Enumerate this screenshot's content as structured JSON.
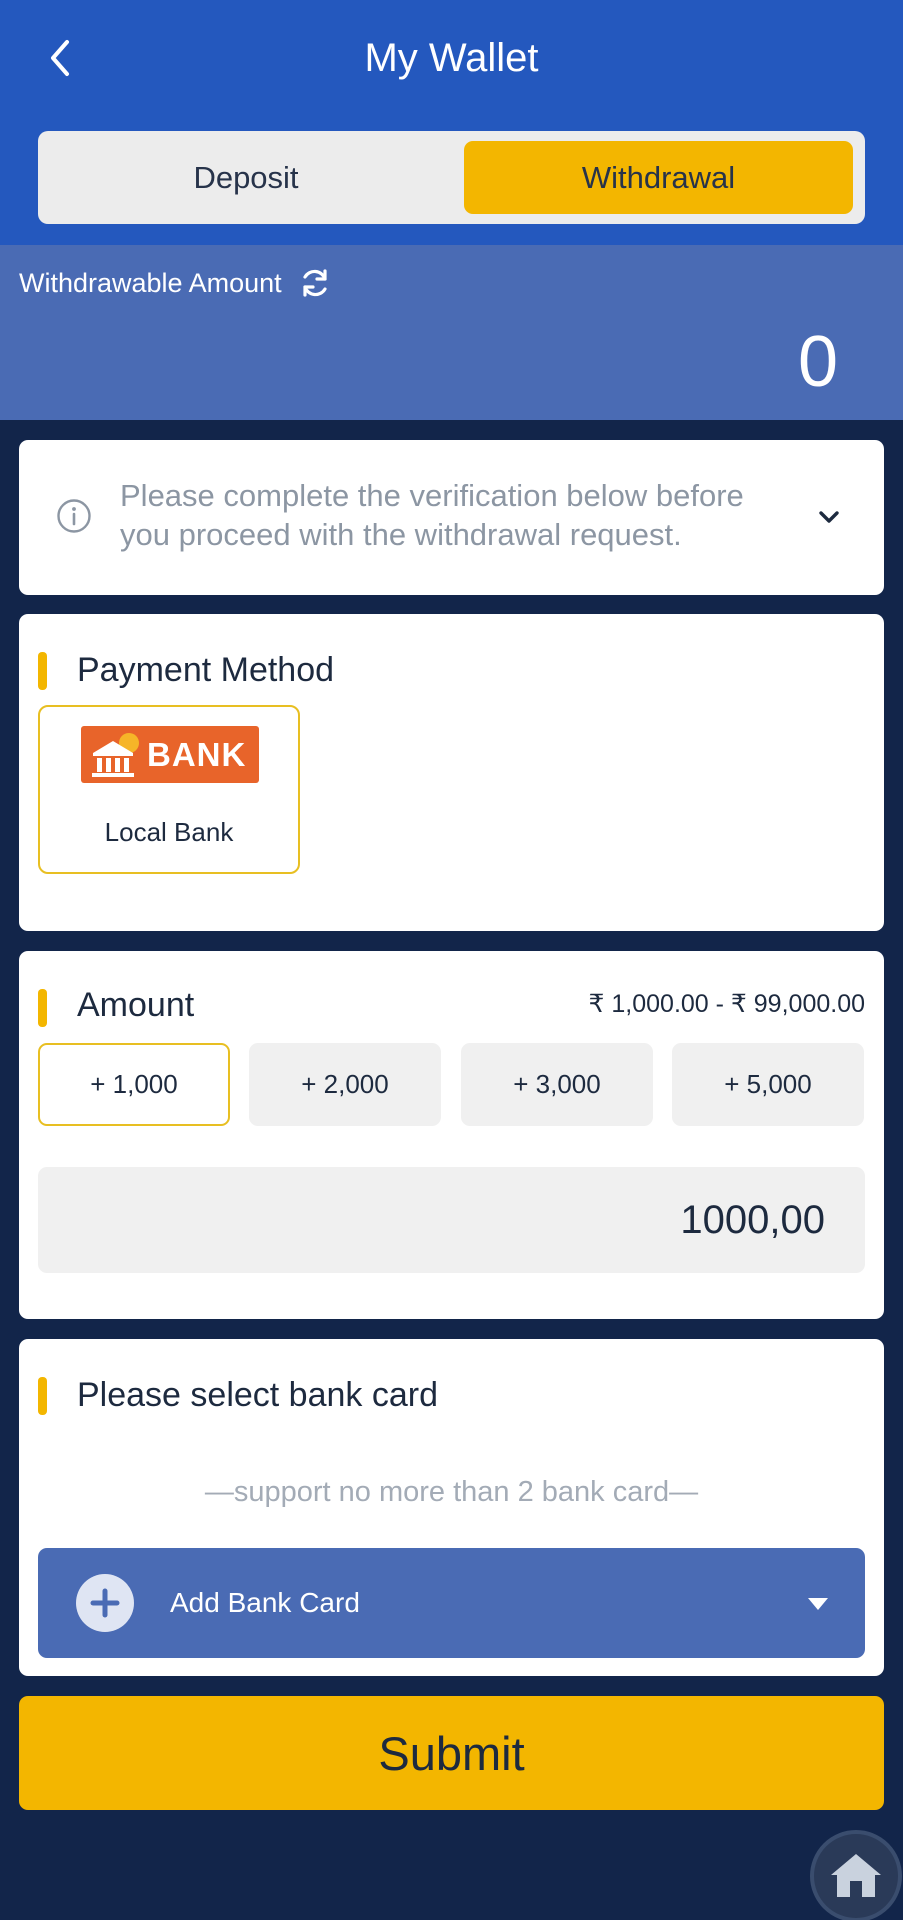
{
  "header": {
    "title": "My Wallet",
    "back_icon": "chevron-left-icon",
    "tabs": [
      {
        "label": "Deposit",
        "active": false
      },
      {
        "label": "Withdrawal",
        "active": true
      }
    ]
  },
  "balance": {
    "label": "Withdrawable Amount",
    "refresh_icon": "refresh-icon",
    "value": "0"
  },
  "notice": {
    "icon": "info-icon",
    "text": "Please complete the verification below before you proceed with the withdrawal request.",
    "expand_icon": "chevron-down-icon"
  },
  "payment": {
    "title": "Payment Method",
    "options": [
      {
        "logo_text": "BANK",
        "label": "Local Bank",
        "selected": true
      }
    ]
  },
  "amount": {
    "title": "Amount",
    "range": "₹ 1,000.00 - ₹ 99,000.00",
    "chips": [
      "+ 1,000",
      "+ 2,000",
      "+ 3,000",
      "+ 5,000"
    ],
    "active_chip": 0,
    "input_value": "1000,00"
  },
  "bank_card": {
    "title": "Please select bank card",
    "support_note": "—support no more than 2 bank card—",
    "add_label": "Add Bank Card"
  },
  "submit_label": "Submit",
  "colors": {
    "header_blue": "#2458be",
    "band_blue": "#4a6bb4",
    "accent_yellow": "#f3b600",
    "page_navy": "#12254a",
    "bank_orange": "#e8642a"
  }
}
